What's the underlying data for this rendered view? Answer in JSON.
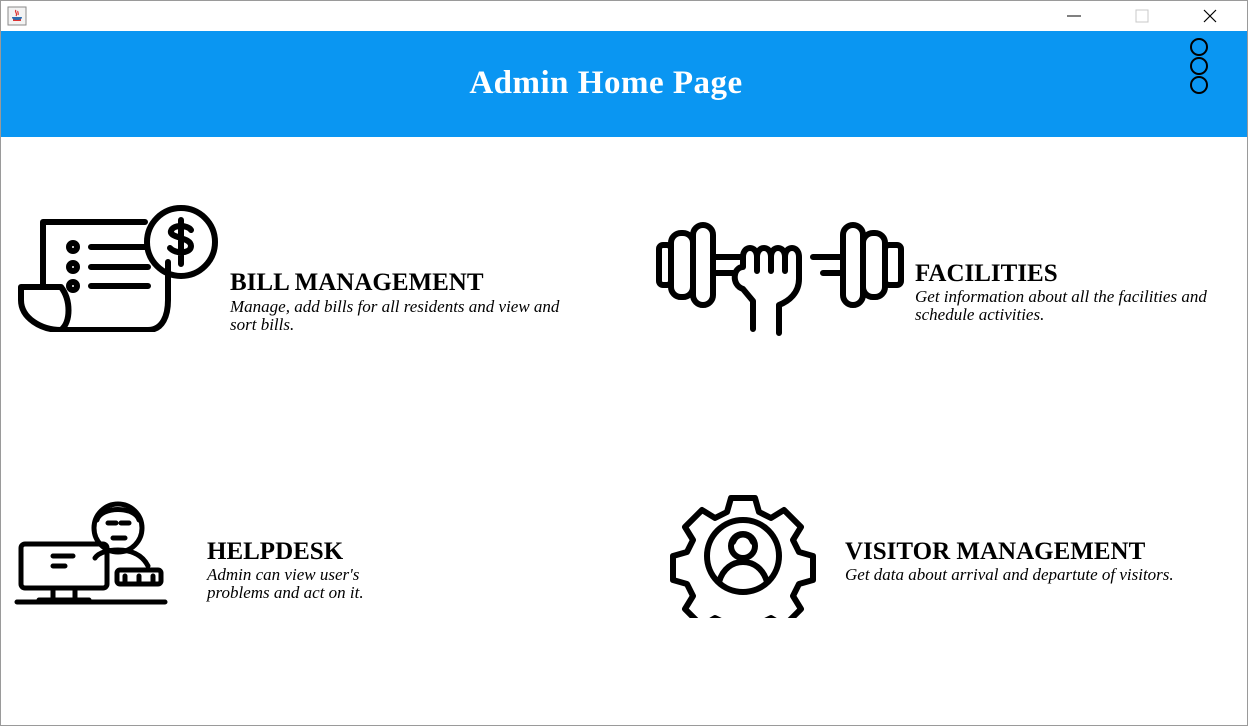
{
  "window": {
    "controls": {
      "minimize_icon": "minimize-icon",
      "maximize_icon": "maximize-icon",
      "close_icon": "close-icon"
    }
  },
  "header": {
    "title": "Admin Home Page",
    "background": "#0a96f2",
    "menu_icon": "three-circles-menu-icon"
  },
  "modules": [
    {
      "title": "BILL MANAGEMENT",
      "description": "Manage, add bills for all residents and view and sort bills.",
      "icon": "bill-dollar-icon"
    },
    {
      "title": "FACILITIES",
      "description": "Get information about all the facilities and schedule activities.",
      "icon": "dumbbell-fist-icon"
    },
    {
      "title": "HELPDESK",
      "description": "Admin can view user's problems and act on it.",
      "icon": "helpdesk-computer-icon"
    },
    {
      "title": "VISITOR MANAGEMENT",
      "description": "Get data about arrival and departute of visitors.",
      "icon": "gear-person-icon"
    }
  ]
}
